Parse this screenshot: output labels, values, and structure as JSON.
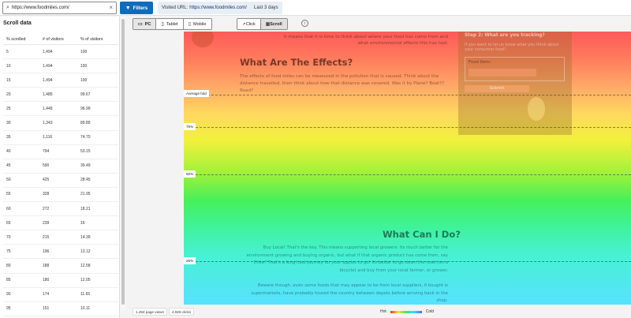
{
  "topbar": {
    "url": "https://www.foodmiles.com/",
    "filters_label": "Filters",
    "visited_label": "Visited URL:",
    "visited_url": "https://www.foodmiles.com/",
    "date_range": "Last 3 days"
  },
  "sidebar": {
    "title": "Scroll data",
    "columns": [
      "% scrolled",
      "# of visitors",
      "% of visitors"
    ],
    "rows": [
      [
        "5",
        "1,494",
        "100"
      ],
      [
        "10",
        "1,494",
        "100"
      ],
      [
        "15",
        "1,494",
        "100"
      ],
      [
        "20",
        "1,485",
        "99.67"
      ],
      [
        "25",
        "1,449",
        "96.99"
      ],
      [
        "30",
        "1,343",
        "89.89"
      ],
      [
        "35",
        "1,116",
        "74.70"
      ],
      [
        "40",
        "794",
        "53.15"
      ],
      [
        "45",
        "590",
        "39.49"
      ],
      [
        "50",
        "425",
        "28.45"
      ],
      [
        "55",
        "328",
        "21.95"
      ],
      [
        "60",
        "272",
        "18.21"
      ],
      [
        "65",
        "239",
        "16"
      ],
      [
        "70",
        "215",
        "14.39"
      ],
      [
        "75",
        "196",
        "13.12"
      ],
      [
        "80",
        "188",
        "12.58"
      ],
      [
        "85",
        "180",
        "12.05"
      ],
      [
        "90",
        "174",
        "11.65"
      ],
      [
        "95",
        "151",
        "10.11"
      ]
    ]
  },
  "toolbar": {
    "devices": [
      "PC",
      "Tablet",
      "Mobile"
    ],
    "modes": [
      "Click",
      "Scroll"
    ]
  },
  "heatmap": {
    "labels": {
      "average_fold": "Average fold",
      "p75": "75%",
      "p50": "50%",
      "p25": "25%"
    },
    "page": {
      "intro_line1": "It means that it is time to think about where your food has come from and",
      "intro_line2": "what environmental effects this has had.",
      "effects_heading": "What Are The Effects?",
      "effects_body": "The effects of food miles can be measured in the pollution that is caused. Think about the distance travelled, then think about how that distance was covered. Was it by Plane? Boat?? Road?",
      "step_heading": "Step 2: What are you tracking?",
      "step_body": "If you want to let us know what you think about your consumer food!",
      "food_item_label": "Food Item:",
      "submit_label": "Submit",
      "buy_heading": "What Can I Do?",
      "buy_body": "Buy Local! That's the key. This means supporting local growers. Its much better for the environment growing and buying organic, but what if that organic product has come from, say Chile? That's a long haul journey for your apples to go! Its better to go down the road (on a bicycle) and buy from your local farmer, or grower.",
      "beware_body": "Beware though, even some foods that may appear to be from local suppliers, if bought is supermarkets, have probably toured the country between depots before arriving back in the shop."
    }
  },
  "footer": {
    "page_views": "1,494 page views",
    "clicks": "4,926 clicks",
    "legend_hot": "Hot",
    "legend_cold": "Cold"
  },
  "colors": {
    "accent": "#0f6cbd"
  }
}
